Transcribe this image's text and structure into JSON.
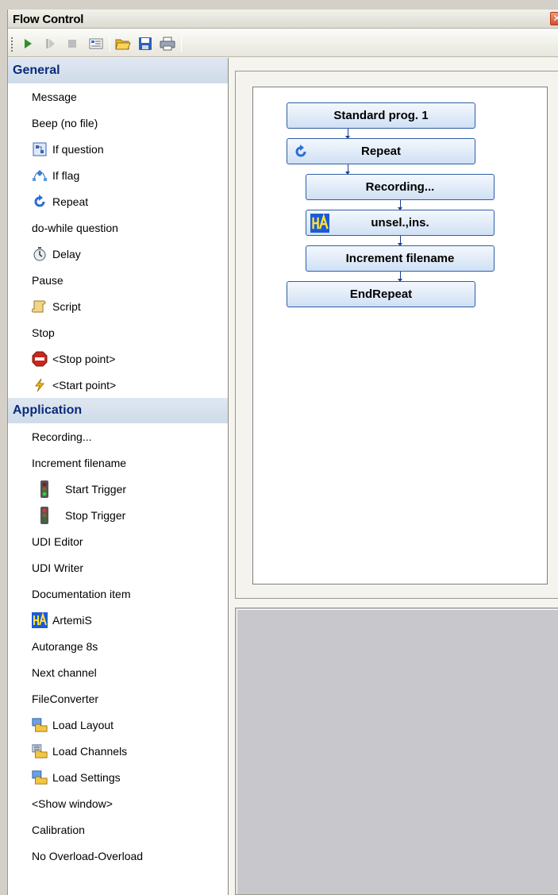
{
  "window": {
    "title": "Flow Control",
    "close_glyph": "✕"
  },
  "toolbar": {
    "buttons": [
      "play-icon",
      "step-icon",
      "stop-icon",
      "properties-icon",
      "open-folder-icon",
      "save-icon",
      "print-icon"
    ]
  },
  "sidebar": {
    "groups": [
      {
        "label": "General",
        "items": [
          {
            "label": "Message",
            "icon": ""
          },
          {
            "label": "Beep (no file)",
            "icon": ""
          },
          {
            "label": "If question",
            "icon": "if-question-icon"
          },
          {
            "label": "If flag",
            "icon": "if-flag-icon"
          },
          {
            "label": "Repeat",
            "icon": "repeat-icon"
          },
          {
            "label": "do-while question",
            "icon": ""
          },
          {
            "label": "Delay",
            "icon": "stopwatch-icon"
          },
          {
            "label": "Pause",
            "icon": ""
          },
          {
            "label": "Script",
            "icon": "script-icon"
          },
          {
            "label": "Stop",
            "icon": ""
          },
          {
            "label": "<Stop point>",
            "icon": "stop-sign-icon"
          },
          {
            "label": "<Start point>",
            "icon": "lightning-icon"
          }
        ]
      },
      {
        "label": "Application",
        "items": [
          {
            "label": "Recording...",
            "icon": ""
          },
          {
            "label": "Increment filename",
            "icon": ""
          },
          {
            "label": "Start Trigger",
            "icon": "traffic-light-green-icon"
          },
          {
            "label": "Stop Trigger",
            "icon": "traffic-light-red-icon"
          },
          {
            "label": "UDI Editor",
            "icon": ""
          },
          {
            "label": "UDI Writer",
            "icon": ""
          },
          {
            "label": "Documentation item",
            "icon": ""
          },
          {
            "label": "ArtemiS",
            "icon": "artemis-icon"
          },
          {
            "label": "Autorange 8s",
            "icon": ""
          },
          {
            "label": "Next channel",
            "icon": ""
          },
          {
            "label": "FileConverter",
            "icon": ""
          },
          {
            "label": "Load Layout",
            "icon": "load-layout-icon"
          },
          {
            "label": "Load Channels",
            "icon": "load-channels-icon"
          },
          {
            "label": "Load Settings",
            "icon": "load-settings-icon"
          },
          {
            "label": "<Show window>",
            "icon": ""
          },
          {
            "label": "Calibration",
            "icon": ""
          },
          {
            "label": "No Overload-Overload",
            "icon": ""
          }
        ]
      }
    ]
  },
  "flow": {
    "nodes": [
      {
        "label": "Standard prog. 1",
        "icon": ""
      },
      {
        "label": "Repeat",
        "icon": "repeat-icon"
      },
      {
        "label": "Recording...",
        "icon": ""
      },
      {
        "label": "unsel.,ins.",
        "icon": "artemis-icon"
      },
      {
        "label": "Increment filename",
        "icon": ""
      },
      {
        "label": "EndRepeat",
        "icon": ""
      }
    ]
  },
  "colors": {
    "accent": "#0b2a7a",
    "node_border": "#2d5ea6",
    "group_header_bg": "#d5e0ec"
  }
}
